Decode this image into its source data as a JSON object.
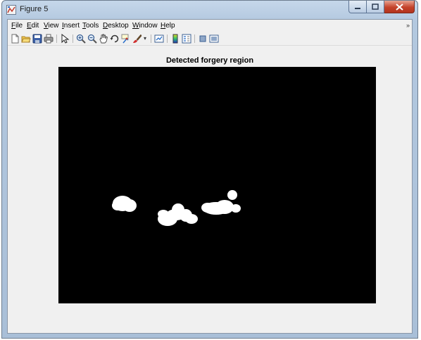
{
  "window": {
    "title": "Figure 5"
  },
  "menu": [
    "File",
    "Edit",
    "View",
    "Insert",
    "Tools",
    "Desktop",
    "Window",
    "Help"
  ],
  "toolbar": {
    "icons": [
      "new-figure-icon",
      "open-file-icon",
      "save-icon",
      "print-icon",
      "pointer-icon",
      "zoom-in-icon",
      "zoom-out-icon",
      "pan-icon",
      "rotate-3d-icon",
      "data-cursor-icon",
      "brush-icon",
      "link-plot-icon",
      "colorbar-icon",
      "legend-icon",
      "hide-plot-tools-icon",
      "show-plot-tools-icon"
    ]
  },
  "figure": {
    "title": "Detected forgery region"
  },
  "colors": {
    "axes_background": "#000000",
    "region_fill": "#ffffff"
  }
}
